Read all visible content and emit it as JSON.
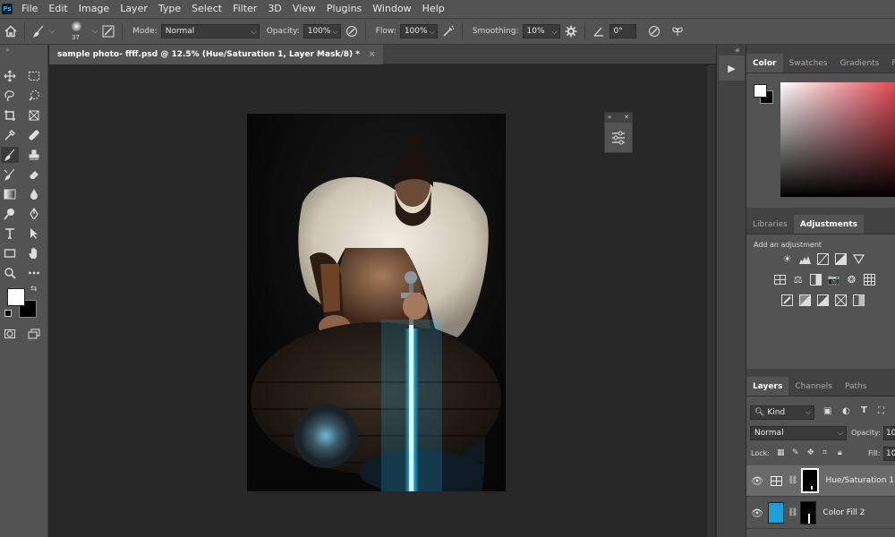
{
  "menubar": {
    "logo": "Ps",
    "items": [
      "File",
      "Edit",
      "Image",
      "Layer",
      "Type",
      "Select",
      "Filter",
      "3D",
      "View",
      "Plugins",
      "Window",
      "Help"
    ]
  },
  "options": {
    "brush_size": "37",
    "mode_label": "Mode:",
    "mode_value": "Normal",
    "opacity_label": "Opacity:",
    "opacity_value": "100%",
    "flow_label": "Flow:",
    "flow_value": "100%",
    "smoothing_label": "Smoothing:",
    "smoothing_value": "10%",
    "angle_value": "0°"
  },
  "document": {
    "tab_title": "sample photo- ffff.psd @ 12.5% (Hue/Saturation 1, Layer Mask/8) *",
    "close_glyph": "×"
  },
  "panels": {
    "color_tabs": [
      "Color",
      "Swatches",
      "Gradients",
      "Patte"
    ],
    "adjust_tabs": [
      "Libraries",
      "Adjustments"
    ],
    "add_adjustment": "Add an adjustment",
    "layers_tabs": [
      "Layers",
      "Channels",
      "Paths"
    ],
    "kind_label": "Kind",
    "blend_mode": "Normal",
    "opacity_label": "Opacity:",
    "opacity_value": "10",
    "lock_label": "Lock:",
    "fill_label": "Fill:",
    "fill_value": "10"
  },
  "layers": [
    {
      "name": "Hue/Saturation 1",
      "selected": true
    },
    {
      "name": "Color Fill 2",
      "selected": false
    }
  ],
  "colors": {
    "foreground": "#ffffff",
    "background": "#000000",
    "color_fill_layer": "#1e9ed6",
    "saber_glow": "#2ec8ff"
  }
}
